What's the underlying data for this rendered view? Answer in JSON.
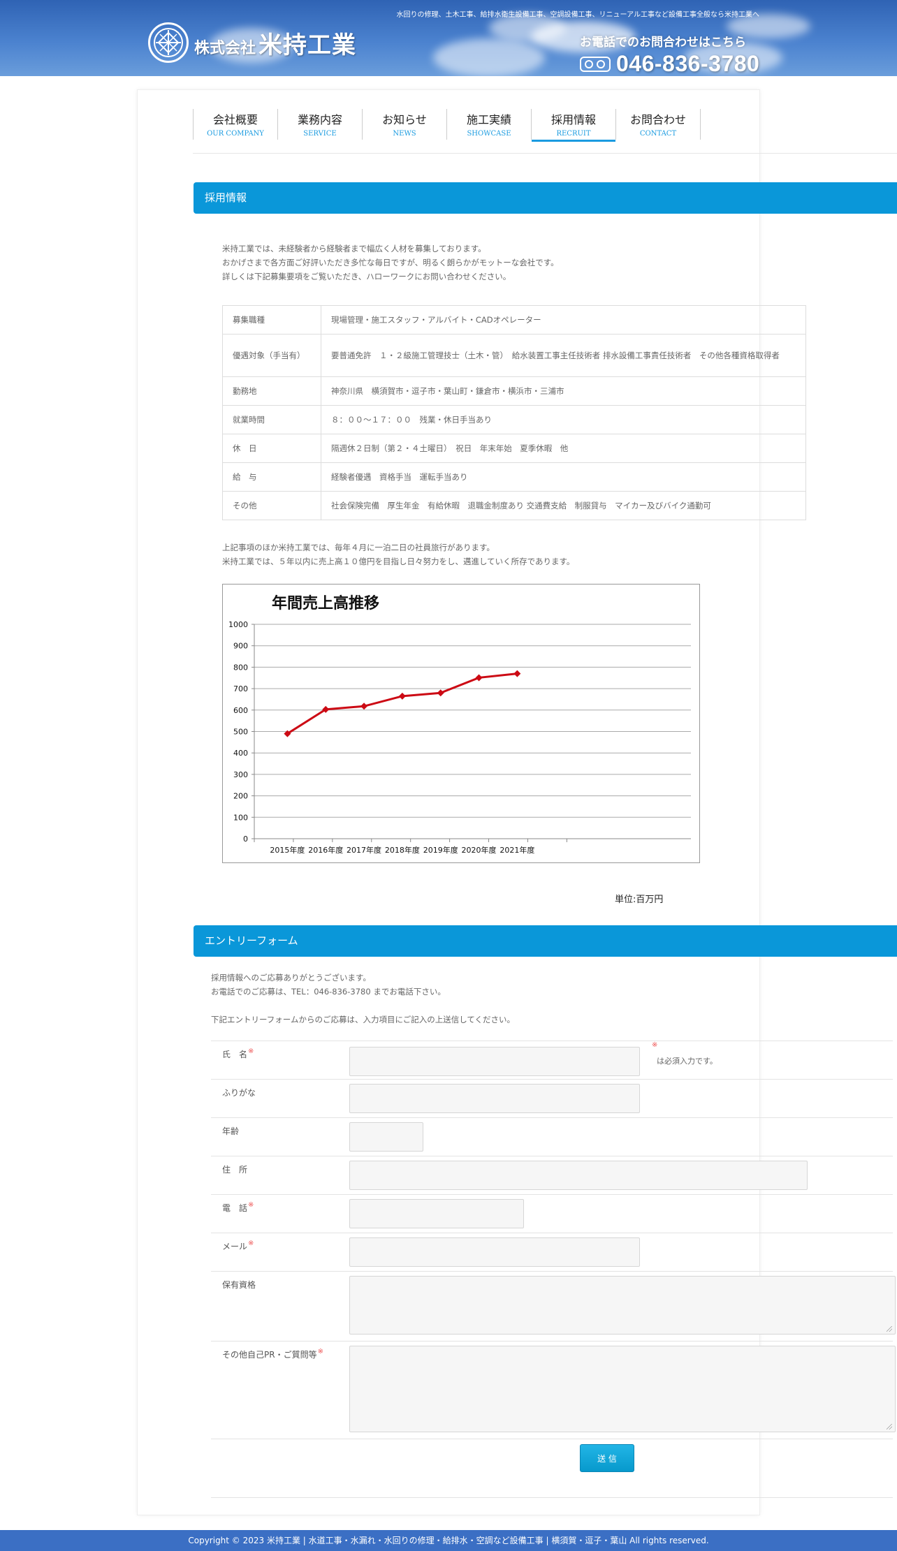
{
  "header": {
    "tagline": "水回りの修理、土木工事、給排水衛生設備工事、空調設備工事、リニューアル工事など設備工事全般なら米持工業へ",
    "logo_small": "株式会社",
    "logo_big": "米持工業",
    "phone_label": "お電話でのお問合わせはこちら",
    "phone_icon": "free-dial-icon",
    "phone_number": "046-836-3780"
  },
  "nav": [
    {
      "ja": "会社概要",
      "en": "OUR COMPANY",
      "active": false
    },
    {
      "ja": "業務内容",
      "en": "SERVICE",
      "active": false
    },
    {
      "ja": "お知らせ",
      "en": "NEWS",
      "active": false
    },
    {
      "ja": "施工実績",
      "en": "SHOWCASE",
      "active": false
    },
    {
      "ja": "採用情報",
      "en": "RECRUIT",
      "active": true
    },
    {
      "ja": "お問合わせ",
      "en": "CONTACT",
      "active": false
    }
  ],
  "recruit": {
    "title": "採用情報",
    "intro": [
      "米持工業では、未経験者から経験者まで幅広く人材を募集しております。",
      "おかげさまで各方面ご好評いただき多忙な毎日ですが、明るく朗らかがモットーな会社です。",
      "詳しくは下記募集要項をご覧いただき、ハローワークにお問い合わせください。"
    ],
    "table": [
      {
        "k": "募集職種",
        "v": "現場管理・施工スタッフ・アルバイト・CADオペレーター"
      },
      {
        "k": "優遇対象（手当有）",
        "v": "要普通免許　１・２級施工管理技士（土木・管）　給水装置工事主任技術者 排水設備工事責任技術者　その他各種資格取得者"
      },
      {
        "k": "勤務地",
        "v": "神奈川県　横須賀市・逗子市・葉山町・鎌倉市・横浜市・三浦市"
      },
      {
        "k": "就業時間",
        "v": "８：００〜１７：００　残業・休日手当あり"
      },
      {
        "k": "休　日",
        "v": "隔週休２日制（第２・４土曜日）　祝日　年末年始　夏季休暇　他"
      },
      {
        "k": "給　与",
        "v": "経験者優遇　資格手当　運転手当あり"
      },
      {
        "k": "その他",
        "v": "社会保険完備　厚生年金　有給休暇　退職金制度あり 交通費支給　制服貸与　マイカー及びバイク通勤可"
      }
    ],
    "after": [
      "上記事項のほか米持工業では、毎年４月に一泊二日の社員旅行があります。",
      "米持工業では、５年以内に売上高１０億円を目指し日々努力をし、邁進していく所存であります。"
    ],
    "unit": "単位:百万円"
  },
  "chart_data": {
    "type": "line",
    "title": "年間売上高推移",
    "categories": [
      "2015年度",
      "2016年度",
      "2017年度",
      "2018年度",
      "2019年度",
      "2020年度",
      "2021年度"
    ],
    "series": [
      {
        "values": [
          490,
          603,
          618,
          665,
          680,
          751,
          770
        ]
      }
    ],
    "ylim": [
      0,
      1000
    ],
    "yticks": [
      "0",
      "100",
      "200",
      "300",
      "400",
      "500",
      "600",
      "700",
      "800",
      "900",
      "1000"
    ],
    "grid": true,
    "color": "#cc0a14"
  },
  "entry": {
    "title": "エントリーフォーム",
    "intro": [
      "採用情報へのご応募ありがとうございます。",
      "お電話でのご応募は、TEL：046-836-3780 までお電話下さい。"
    ],
    "intro2": "下記エントリーフォームからのご応募は、入力項目にご記入の上送信してください。",
    "required_mark": "※",
    "required_note": "は必須入力です。",
    "fields": [
      {
        "label": "氏　名",
        "required": true
      },
      {
        "label": "ふりがな",
        "required": false
      },
      {
        "label": "年齢",
        "required": false
      },
      {
        "label": "住　所",
        "required": false
      },
      {
        "label": "電　話",
        "required": true
      },
      {
        "label": "メール",
        "required": true
      },
      {
        "label": "保有資格",
        "required": false
      },
      {
        "label": "その他自己PR・ご質問等",
        "required": true
      }
    ],
    "submit": "送 信"
  },
  "footer": "Copyright © 2023 米持工業 | 水道工事・水漏れ・水回りの修理・給排水・空調など設備工事 | 横須賀・逗子・葉山 All rights reserved."
}
